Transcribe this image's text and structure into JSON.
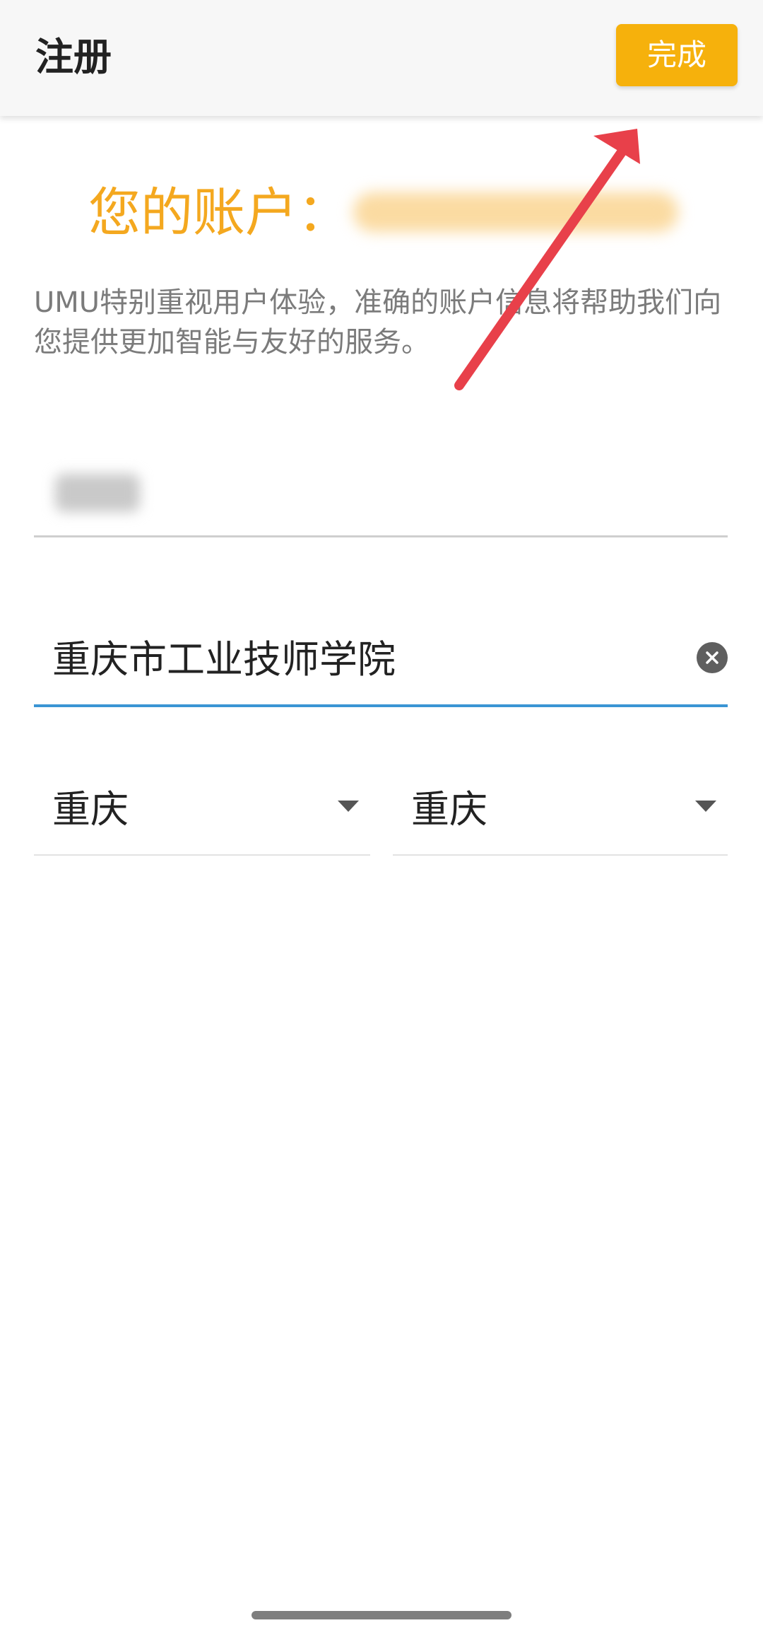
{
  "header": {
    "title": "注册",
    "done_label": "完成"
  },
  "account": {
    "label": "您的账户：",
    "value": "账户"
  },
  "intro_text": "UMU特别重视用户体验，准确的账户信息将帮助我们向您提供更加智能与友好的服务。",
  "form": {
    "name_value": "姓名",
    "school_value": "重庆市工业技师学院",
    "province_value": "重庆",
    "city_value": "重庆"
  },
  "icons": {
    "clear": "clear-icon",
    "dropdown": "caret-down-icon",
    "annotation": "red-arrow-annotation"
  },
  "colors": {
    "accent": "#f6b10c",
    "account_label": "#f4a81f",
    "focus_underline": "#3b95d4",
    "annotation_arrow": "#e8404a"
  }
}
